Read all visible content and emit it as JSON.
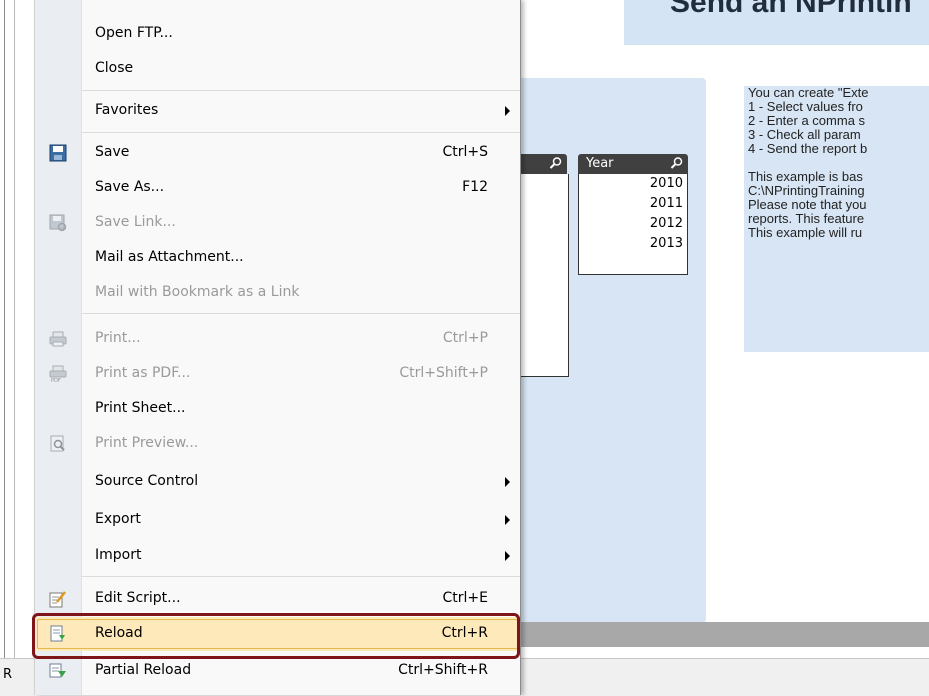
{
  "background": {
    "sheet_title": "Send an NPrintin",
    "year_list": {
      "header": "Year",
      "items": [
        "2010",
        "2011",
        "2012",
        "2013"
      ]
    },
    "info_text": [
      "You can create \"Exte",
      "1 - Select values fro",
      "2 - Enter a comma s",
      "3 - Check all param",
      "4 - Send the report b",
      "",
      "This example is bas",
      "C:\\NPrintingTraining",
      "Please note that you",
      "reports. This feature",
      "This example will ru"
    ],
    "status_label": "R"
  },
  "menu": {
    "items": [
      {
        "label": "Open FTP...",
        "shortcut": "",
        "enabled": true,
        "submenu": false,
        "icon": ""
      },
      {
        "label": "Close",
        "shortcut": "",
        "enabled": true,
        "submenu": false,
        "icon": ""
      },
      {
        "label": "Favorites",
        "shortcut": "",
        "enabled": true,
        "submenu": true,
        "icon": ""
      },
      {
        "label": "Save",
        "shortcut": "Ctrl+S",
        "enabled": true,
        "submenu": false,
        "icon": "save-icon"
      },
      {
        "label": "Save As...",
        "shortcut": "F12",
        "enabled": true,
        "submenu": false,
        "icon": ""
      },
      {
        "label": "Save Link...",
        "shortcut": "",
        "enabled": false,
        "submenu": false,
        "icon": "save-link-icon"
      },
      {
        "label": "Mail as Attachment...",
        "shortcut": "",
        "enabled": true,
        "submenu": false,
        "icon": ""
      },
      {
        "label": "Mail with Bookmark as a Link",
        "shortcut": "",
        "enabled": false,
        "submenu": false,
        "icon": ""
      },
      {
        "label": "Print...",
        "shortcut": "Ctrl+P",
        "enabled": false,
        "submenu": false,
        "icon": "printer-icon"
      },
      {
        "label": "Print as PDF...",
        "shortcut": "Ctrl+Shift+P",
        "enabled": false,
        "submenu": false,
        "icon": "pdf-printer-icon"
      },
      {
        "label": "Print Sheet...",
        "shortcut": "",
        "enabled": true,
        "submenu": false,
        "icon": ""
      },
      {
        "label": "Print Preview...",
        "shortcut": "",
        "enabled": false,
        "submenu": false,
        "icon": "print-preview-icon"
      },
      {
        "label": "Source Control",
        "shortcut": "",
        "enabled": true,
        "submenu": true,
        "icon": ""
      },
      {
        "label": "Export",
        "shortcut": "",
        "enabled": true,
        "submenu": true,
        "icon": ""
      },
      {
        "label": "Import",
        "shortcut": "",
        "enabled": true,
        "submenu": true,
        "icon": ""
      },
      {
        "label": "Edit Script...",
        "shortcut": "Ctrl+E",
        "enabled": true,
        "submenu": false,
        "icon": "edit-script-icon"
      },
      {
        "label": "Reload",
        "shortcut": "Ctrl+R",
        "enabled": true,
        "submenu": false,
        "icon": "reload-icon",
        "highlighted": true
      },
      {
        "label": "Partial Reload",
        "shortcut": "Ctrl+Shift+R",
        "enabled": true,
        "submenu": false,
        "icon": "partial-reload-icon"
      }
    ]
  },
  "colors": {
    "highlight_frame": "#7e1519",
    "highlight_bg": "#fde9b9",
    "panel_blue": "#d7e5f4"
  }
}
